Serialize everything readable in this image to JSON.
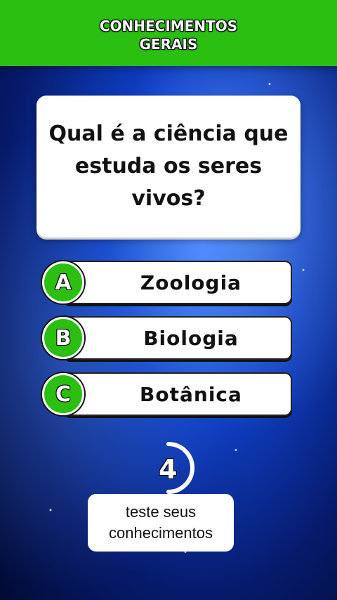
{
  "header": {
    "title_line1": "CONHECIMENTOS",
    "title_line2": "GERAIS",
    "color": "#2bbf12"
  },
  "question": {
    "text": "Qual é a ciência que estuda os seres vivos?"
  },
  "answers": [
    {
      "letter": "A",
      "label": "Zoologia"
    },
    {
      "letter": "B",
      "label": "Biologia"
    },
    {
      "letter": "C",
      "label": "Botânica"
    }
  ],
  "timer": {
    "seconds": "4",
    "icon": "countdown-ring-icon"
  },
  "footer": {
    "line1": "teste seus",
    "line2": "conhecimentos"
  }
}
